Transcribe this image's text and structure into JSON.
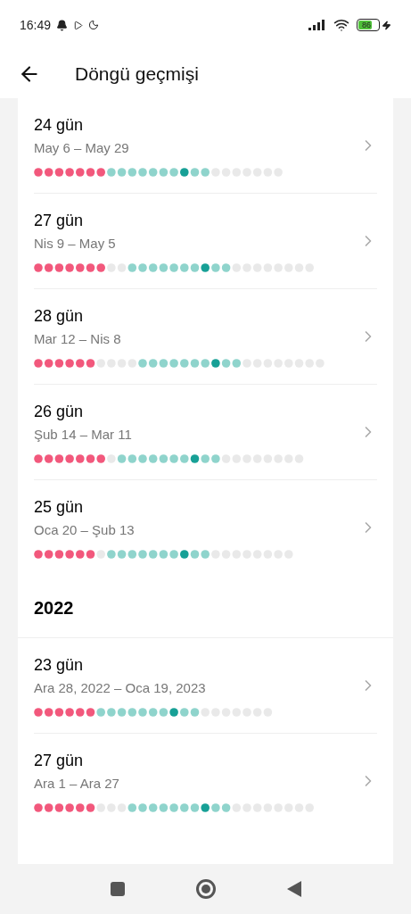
{
  "status_bar": {
    "time": "16:49",
    "battery": "86"
  },
  "header": {
    "title": "Döngü geçmişi"
  },
  "sections": [
    {
      "kind": "cycles",
      "cycles": [
        {
          "length": "24 gün",
          "dates": "May 6 – May 29",
          "dots": [
            {
              "kind": "period"
            },
            {
              "kind": "period"
            },
            {
              "kind": "period"
            },
            {
              "kind": "period"
            },
            {
              "kind": "period"
            },
            {
              "kind": "period"
            },
            {
              "kind": "period"
            },
            {
              "kind": "fertile"
            },
            {
              "kind": "fertile"
            },
            {
              "kind": "fertile"
            },
            {
              "kind": "fertile"
            },
            {
              "kind": "fertile"
            },
            {
              "kind": "fertile"
            },
            {
              "kind": "fertile"
            },
            {
              "kind": "ovulation"
            },
            {
              "kind": "fertile"
            },
            {
              "kind": "fertile"
            },
            {
              "kind": "other"
            },
            {
              "kind": "other"
            },
            {
              "kind": "other"
            },
            {
              "kind": "other"
            },
            {
              "kind": "other"
            },
            {
              "kind": "other"
            },
            {
              "kind": "other"
            }
          ]
        },
        {
          "length": "27 gün",
          "dates": "Nis 9 – May 5",
          "dots": [
            {
              "kind": "period"
            },
            {
              "kind": "period"
            },
            {
              "kind": "period"
            },
            {
              "kind": "period"
            },
            {
              "kind": "period"
            },
            {
              "kind": "period"
            },
            {
              "kind": "period"
            },
            {
              "kind": "other"
            },
            {
              "kind": "other"
            },
            {
              "kind": "fertile"
            },
            {
              "kind": "fertile"
            },
            {
              "kind": "fertile"
            },
            {
              "kind": "fertile"
            },
            {
              "kind": "fertile"
            },
            {
              "kind": "fertile"
            },
            {
              "kind": "fertile"
            },
            {
              "kind": "ovulation"
            },
            {
              "kind": "fertile"
            },
            {
              "kind": "fertile"
            },
            {
              "kind": "other"
            },
            {
              "kind": "other"
            },
            {
              "kind": "other"
            },
            {
              "kind": "other"
            },
            {
              "kind": "other"
            },
            {
              "kind": "other"
            },
            {
              "kind": "other"
            },
            {
              "kind": "other"
            }
          ]
        },
        {
          "length": "28 gün",
          "dates": "Mar 12 – Nis 8",
          "dots": [
            {
              "kind": "period"
            },
            {
              "kind": "period"
            },
            {
              "kind": "period"
            },
            {
              "kind": "period"
            },
            {
              "kind": "period"
            },
            {
              "kind": "period"
            },
            {
              "kind": "other"
            },
            {
              "kind": "other"
            },
            {
              "kind": "other"
            },
            {
              "kind": "other"
            },
            {
              "kind": "fertile"
            },
            {
              "kind": "fertile"
            },
            {
              "kind": "fertile"
            },
            {
              "kind": "fertile"
            },
            {
              "kind": "fertile"
            },
            {
              "kind": "fertile"
            },
            {
              "kind": "fertile"
            },
            {
              "kind": "ovulation"
            },
            {
              "kind": "fertile"
            },
            {
              "kind": "fertile"
            },
            {
              "kind": "other"
            },
            {
              "kind": "other"
            },
            {
              "kind": "other"
            },
            {
              "kind": "other"
            },
            {
              "kind": "other"
            },
            {
              "kind": "other"
            },
            {
              "kind": "other"
            },
            {
              "kind": "other"
            }
          ]
        },
        {
          "length": "26 gün",
          "dates": "Şub 14 – Mar 11",
          "dots": [
            {
              "kind": "period"
            },
            {
              "kind": "period"
            },
            {
              "kind": "period"
            },
            {
              "kind": "period"
            },
            {
              "kind": "period"
            },
            {
              "kind": "period"
            },
            {
              "kind": "period"
            },
            {
              "kind": "other"
            },
            {
              "kind": "fertile"
            },
            {
              "kind": "fertile"
            },
            {
              "kind": "fertile"
            },
            {
              "kind": "fertile"
            },
            {
              "kind": "fertile"
            },
            {
              "kind": "fertile"
            },
            {
              "kind": "fertile"
            },
            {
              "kind": "ovulation"
            },
            {
              "kind": "fertile"
            },
            {
              "kind": "fertile"
            },
            {
              "kind": "other"
            },
            {
              "kind": "other"
            },
            {
              "kind": "other"
            },
            {
              "kind": "other"
            },
            {
              "kind": "other"
            },
            {
              "kind": "other"
            },
            {
              "kind": "other"
            },
            {
              "kind": "other"
            }
          ]
        },
        {
          "length": "25 gün",
          "dates": "Oca 20 – Şub 13",
          "dots": [
            {
              "kind": "period"
            },
            {
              "kind": "period"
            },
            {
              "kind": "period"
            },
            {
              "kind": "period"
            },
            {
              "kind": "period"
            },
            {
              "kind": "period"
            },
            {
              "kind": "other"
            },
            {
              "kind": "fertile"
            },
            {
              "kind": "fertile"
            },
            {
              "kind": "fertile"
            },
            {
              "kind": "fertile"
            },
            {
              "kind": "fertile"
            },
            {
              "kind": "fertile"
            },
            {
              "kind": "fertile"
            },
            {
              "kind": "ovulation"
            },
            {
              "kind": "fertile"
            },
            {
              "kind": "fertile"
            },
            {
              "kind": "other"
            },
            {
              "kind": "other"
            },
            {
              "kind": "other"
            },
            {
              "kind": "other"
            },
            {
              "kind": "other"
            },
            {
              "kind": "other"
            },
            {
              "kind": "other"
            },
            {
              "kind": "other"
            }
          ]
        }
      ]
    },
    {
      "kind": "year",
      "label": "2022"
    },
    {
      "kind": "cycles",
      "cycles": [
        {
          "length": "23 gün",
          "dates": "Ara 28, 2022 – Oca 19, 2023",
          "dots": [
            {
              "kind": "period"
            },
            {
              "kind": "period"
            },
            {
              "kind": "period"
            },
            {
              "kind": "period"
            },
            {
              "kind": "period"
            },
            {
              "kind": "period"
            },
            {
              "kind": "fertile"
            },
            {
              "kind": "fertile"
            },
            {
              "kind": "fertile"
            },
            {
              "kind": "fertile"
            },
            {
              "kind": "fertile"
            },
            {
              "kind": "fertile"
            },
            {
              "kind": "fertile"
            },
            {
              "kind": "ovulation"
            },
            {
              "kind": "fertile"
            },
            {
              "kind": "fertile"
            },
            {
              "kind": "other"
            },
            {
              "kind": "other"
            },
            {
              "kind": "other"
            },
            {
              "kind": "other"
            },
            {
              "kind": "other"
            },
            {
              "kind": "other"
            },
            {
              "kind": "other"
            }
          ]
        },
        {
          "length": "27 gün",
          "dates": "Ara 1 – Ara 27",
          "dots": [
            {
              "kind": "period"
            },
            {
              "kind": "period"
            },
            {
              "kind": "period"
            },
            {
              "kind": "period"
            },
            {
              "kind": "period"
            },
            {
              "kind": "period"
            },
            {
              "kind": "other"
            },
            {
              "kind": "other"
            },
            {
              "kind": "other"
            },
            {
              "kind": "fertile"
            },
            {
              "kind": "fertile"
            },
            {
              "kind": "fertile"
            },
            {
              "kind": "fertile"
            },
            {
              "kind": "fertile"
            },
            {
              "kind": "fertile"
            },
            {
              "kind": "fertile"
            },
            {
              "kind": "ovulation"
            },
            {
              "kind": "fertile"
            },
            {
              "kind": "fertile"
            },
            {
              "kind": "other"
            },
            {
              "kind": "other"
            },
            {
              "kind": "other"
            },
            {
              "kind": "other"
            },
            {
              "kind": "other"
            },
            {
              "kind": "other"
            },
            {
              "kind": "other"
            },
            {
              "kind": "other"
            }
          ]
        }
      ]
    }
  ]
}
